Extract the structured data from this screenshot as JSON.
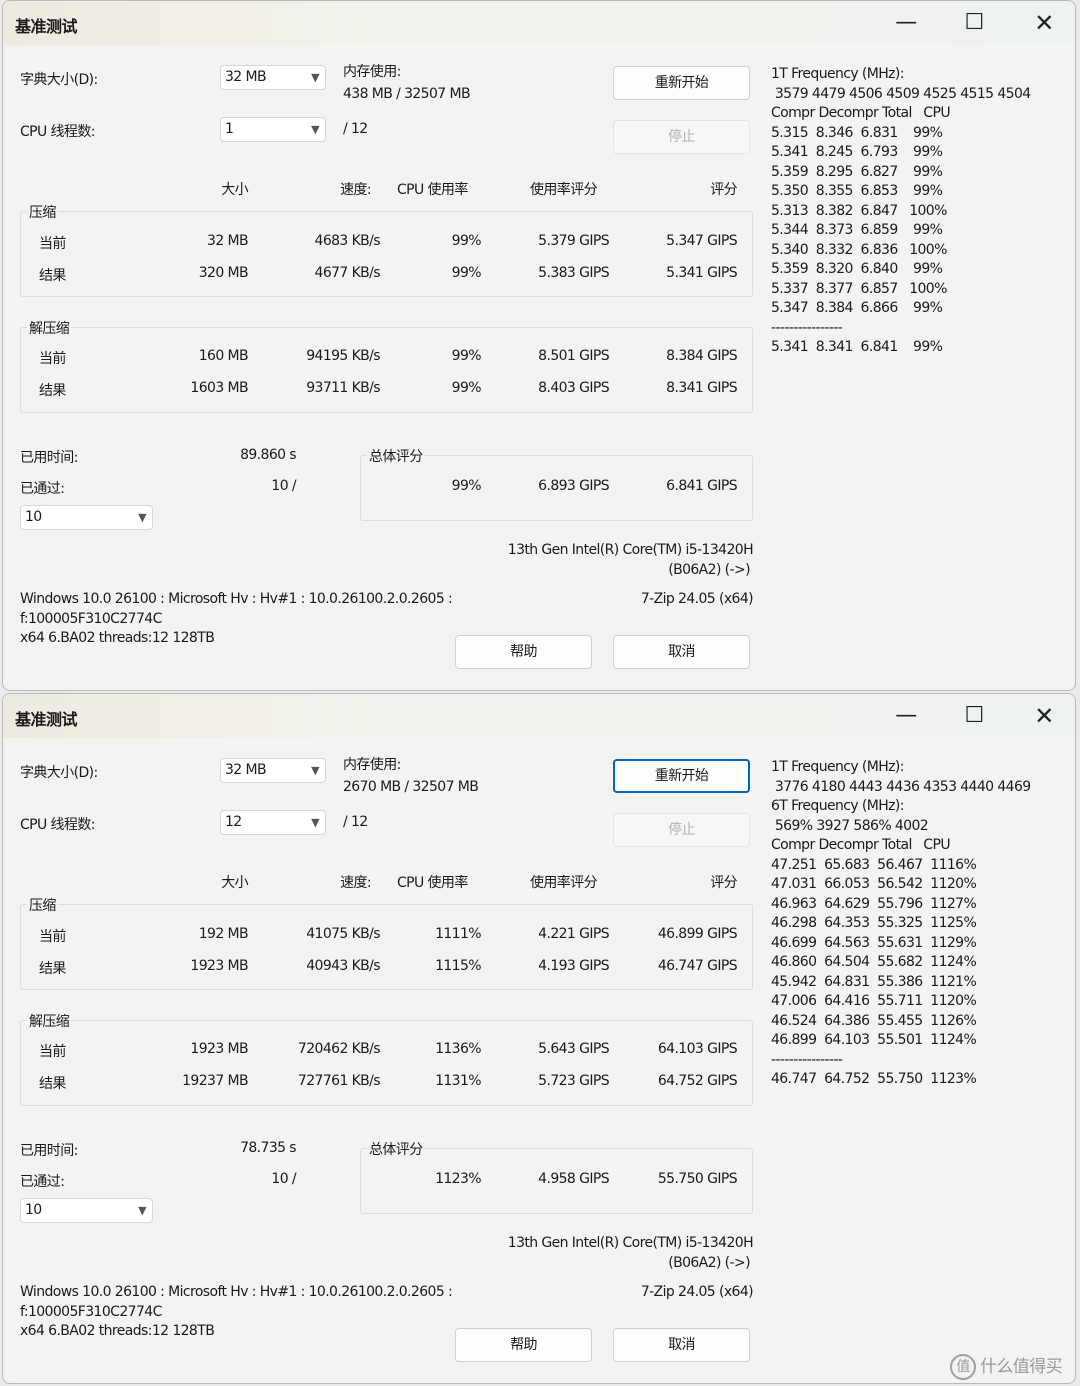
{
  "windows": [
    {
      "title": "基准测试",
      "dict_label": "字典大小(D):",
      "dict_value": "32 MB",
      "threads_label": "CPU 线程数:",
      "threads_value": "1",
      "threads_max": "/ 12",
      "mem_label": "内存使用:",
      "mem_value": "438 MB / 32507 MB",
      "restart_label": "重新开始",
      "stop_label": "停止",
      "headers": [
        "大小",
        "速度:",
        "CPU 使用率",
        "使用率评分",
        "评分"
      ],
      "compress_label": "压缩",
      "compress_rows": [
        {
          "label": "当前",
          "size": "32 MB",
          "speed": "4683 KB/s",
          "cpu": "99%",
          "rating_usage": "5.379 GIPS",
          "rating": "5.347 GIPS"
        },
        {
          "label": "结果",
          "size": "320 MB",
          "speed": "4677 KB/s",
          "cpu": "99%",
          "rating_usage": "5.383 GIPS",
          "rating": "5.341 GIPS"
        }
      ],
      "decompress_label": "解压缩",
      "decompress_rows": [
        {
          "label": "当前",
          "size": "160 MB",
          "speed": "94195 KB/s",
          "cpu": "99%",
          "rating_usage": "8.501 GIPS",
          "rating": "8.384 GIPS"
        },
        {
          "label": "结果",
          "size": "1603 MB",
          "speed": "93711 KB/s",
          "cpu": "99%",
          "rating_usage": "8.403 GIPS",
          "rating": "8.341 GIPS"
        }
      ],
      "elapsed_label": "已用时间:",
      "elapsed_value": "89.860 s",
      "passed_label": "已通过:",
      "passed_value": "10 /",
      "passes_select": "10",
      "total_label": "总体评分",
      "total": {
        "cpu": "99%",
        "rating_usage": "6.893 GIPS",
        "rating": "6.841 GIPS"
      },
      "cpu_name_1": "13th Gen Intel(R) Core(TM) i5-13420H",
      "cpu_name_2": "(B06A2) (->)",
      "version": "7-Zip 24.05 (x64)",
      "sys_1": "Windows 10.0 26100 : Microsoft Hv : Hv#1 : 10.0.26100.2.0.2605 :",
      "sys_2": "f:100005F310C2774C",
      "sys_3": "x64 6.BA02 threads:12 128TB",
      "help_label": "帮助",
      "cancel_label": "取消",
      "right_panel": "1T Frequency (MHz):\n 3579 4479 4506 4509 4525 4515 4504\nCompr Decompr Total   CPU\n5.315  8.346  6.831    99%\n5.341  8.245  6.793    99%\n5.359  8.295  6.827    99%\n5.350  8.355  6.853    99%\n5.313  8.382  6.847   100%\n5.344  8.373  6.859    99%\n5.340  8.332  6.836   100%\n5.359  8.320  6.840    99%\n5.337  8.377  6.857   100%\n5.347  8.384  6.866    99%\n----------------\n5.341  8.341  6.841    99%"
    },
    {
      "title": "基准测试",
      "dict_label": "字典大小(D):",
      "dict_value": "32 MB",
      "threads_label": "CPU 线程数:",
      "threads_value": "12",
      "threads_max": "/ 12",
      "mem_label": "内存使用:",
      "mem_value": "2670 MB / 32507 MB",
      "restart_label": "重新开始",
      "stop_label": "停止",
      "headers": [
        "大小",
        "速度:",
        "CPU 使用率",
        "使用率评分",
        "评分"
      ],
      "compress_label": "压缩",
      "compress_rows": [
        {
          "label": "当前",
          "size": "192 MB",
          "speed": "41075 KB/s",
          "cpu": "1111%",
          "rating_usage": "4.221 GIPS",
          "rating": "46.899 GIPS"
        },
        {
          "label": "结果",
          "size": "1923 MB",
          "speed": "40943 KB/s",
          "cpu": "1115%",
          "rating_usage": "4.193 GIPS",
          "rating": "46.747 GIPS"
        }
      ],
      "decompress_label": "解压缩",
      "decompress_rows": [
        {
          "label": "当前",
          "size": "1923 MB",
          "speed": "720462 KB/s",
          "cpu": "1136%",
          "rating_usage": "5.643 GIPS",
          "rating": "64.103 GIPS"
        },
        {
          "label": "结果",
          "size": "19237 MB",
          "speed": "727761 KB/s",
          "cpu": "1131%",
          "rating_usage": "5.723 GIPS",
          "rating": "64.752 GIPS"
        }
      ],
      "elapsed_label": "已用时间:",
      "elapsed_value": "78.735 s",
      "passed_label": "已通过:",
      "passed_value": "10 /",
      "passes_select": "10",
      "total_label": "总体评分",
      "total": {
        "cpu": "1123%",
        "rating_usage": "4.958 GIPS",
        "rating": "55.750 GIPS"
      },
      "cpu_name_1": "13th Gen Intel(R) Core(TM) i5-13420H",
      "cpu_name_2": "(B06A2) (->)",
      "version": "7-Zip 24.05 (x64)",
      "sys_1": "Windows 10.0 26100 : Microsoft Hv : Hv#1 : 10.0.26100.2.0.2605 :",
      "sys_2": "f:100005F310C2774C",
      "sys_3": "x64 6.BA02 threads:12 128TB",
      "help_label": "帮助",
      "cancel_label": "取消",
      "right_panel": "1T Frequency (MHz):\n 3776 4180 4443 4436 4353 4440 4469\n6T Frequency (MHz):\n 569% 3927 586% 4002\nCompr Decompr Total   CPU\n47.251  65.683  56.467  1116%\n47.031  66.053  56.542  1120%\n46.963  64.629  55.796  1127%\n46.298  64.353  55.325  1125%\n46.699  64.563  55.631  1129%\n46.860  64.504  55.682  1124%\n45.942  64.831  55.386  1121%\n47.006  64.416  55.711  1120%\n46.524  64.386  55.455  1126%\n46.899  64.103  55.501  1124%\n----------------\n46.747  64.752  55.750  1123%"
    }
  ],
  "watermark": "什么值得买",
  "icons": {
    "minimize": "minimize-icon",
    "maximize": "maximize-icon",
    "close": "close-icon",
    "dropdown": "chevron-down-icon",
    "watermark": "smzdm-logo-icon"
  }
}
